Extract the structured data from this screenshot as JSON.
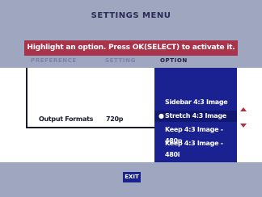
{
  "menu": {
    "title": "SETTINGS MENU",
    "hint": "Highlight an option. Press OK(SELECT) to activate it.",
    "tabs": [
      {
        "label": "PREFERENCE",
        "active": false
      },
      {
        "label": "SETTING",
        "active": false
      },
      {
        "label": "OPTION",
        "active": true
      }
    ]
  },
  "setting_row": {
    "label": "Output Formats",
    "value": "720p"
  },
  "popup": {
    "options": [
      {
        "label": "Sidebar 4:3 Image",
        "selected": false
      },
      {
        "label": "Stretch 4:3 Image",
        "selected": true
      },
      {
        "label": "Keep 4:3 Image - 480p",
        "selected": false
      },
      {
        "label": "Keep 4:3 Image - 480i",
        "selected": false
      }
    ],
    "bullet": "●"
  },
  "footer": {
    "exit_label": "EXIT"
  },
  "colors": {
    "background": "#9ea6c0",
    "hint_bar": "#a8334a",
    "popup": "#1a2190",
    "arrows": "#b03048"
  }
}
